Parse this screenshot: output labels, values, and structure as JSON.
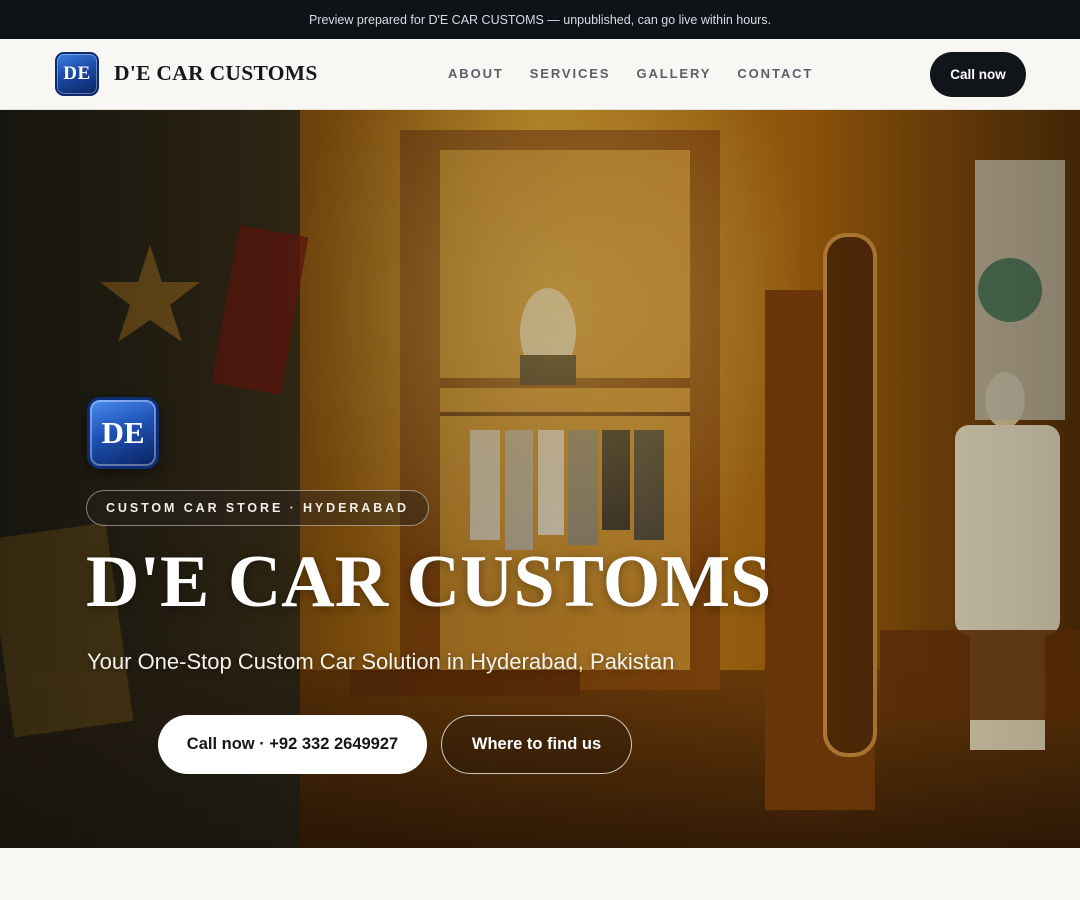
{
  "banner": {
    "text": "Preview prepared for D'E CAR CUSTOMS — unpublished, can go live within hours."
  },
  "nav": {
    "logo_text": "DE",
    "brand": "D'E CAR CUSTOMS",
    "links": [
      "ABOUT",
      "SERVICES",
      "GALLERY",
      "CONTACT"
    ],
    "cta": "Call now"
  },
  "hero": {
    "logo_text": "DE",
    "tag": "CUSTOM CAR STORE · HYDERABAD",
    "title": "D'E CAR CUSTOMS",
    "subtitle": "Your One-Stop Custom Car Solution in Hyderabad, Pakistan",
    "primary_button": "Call now · +92 332 2649927",
    "secondary_button": "Where to find us"
  },
  "colors": {
    "banner_bg": "#0f1318",
    "dark_button": "#111418",
    "logo_blue": "#1b4aa8",
    "page_bg": "#f8f7f4"
  },
  "icons": {
    "logo": "de-logo-badge"
  }
}
